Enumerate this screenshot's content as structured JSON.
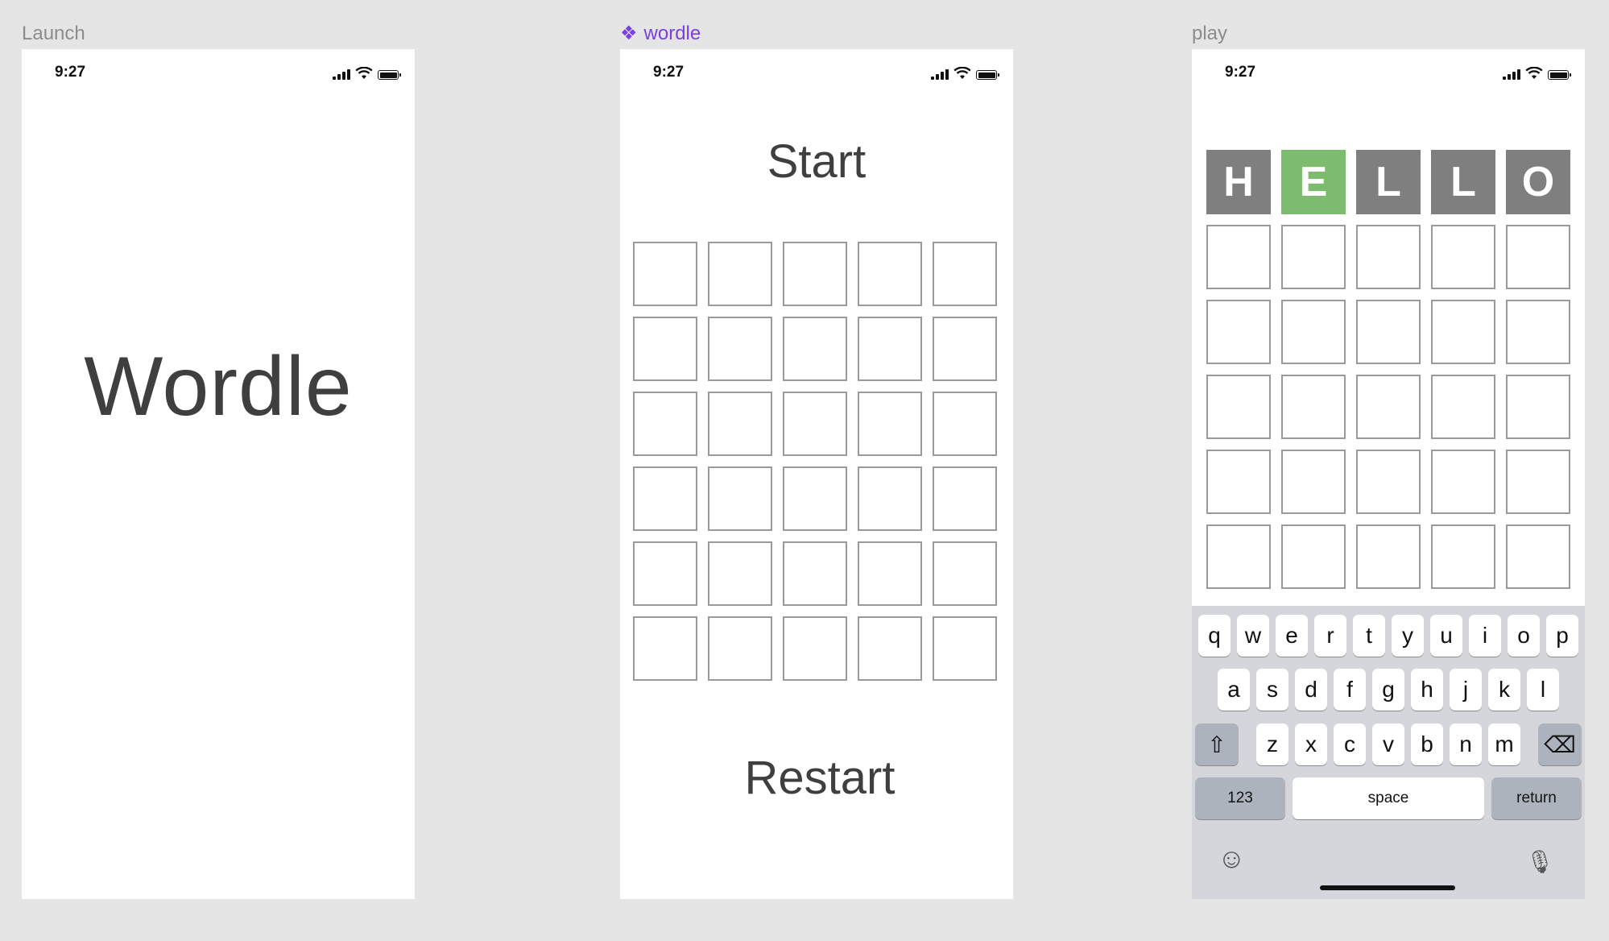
{
  "frames": {
    "launch": {
      "label": "Launch",
      "time": "9:27",
      "title": "Wordle"
    },
    "wordle": {
      "label": "wordle",
      "time": "9:27",
      "start_label": "Start",
      "restart_label": "Restart",
      "rows": 6,
      "cols": 5
    },
    "play": {
      "label": "play",
      "time": "9:27",
      "guess": [
        {
          "letter": "H",
          "state": "gray"
        },
        {
          "letter": "E",
          "state": "green"
        },
        {
          "letter": "L",
          "state": "gray"
        },
        {
          "letter": "L",
          "state": "gray"
        },
        {
          "letter": "O",
          "state": "gray"
        }
      ],
      "empty_rows": 5,
      "keyboard": {
        "row1": [
          "q",
          "w",
          "e",
          "r",
          "t",
          "y",
          "u",
          "i",
          "o",
          "p"
        ],
        "row2": [
          "a",
          "s",
          "d",
          "f",
          "g",
          "h",
          "j",
          "k",
          "l"
        ],
        "row3": [
          "z",
          "x",
          "c",
          "v",
          "b",
          "n",
          "m"
        ],
        "numbers_label": "123",
        "space_label": "space",
        "return_label": "return",
        "shift_icon": "⇧",
        "backspace_icon": "⌫",
        "emoji_icon": "☺",
        "mic_icon": "🎙"
      }
    }
  },
  "colors": {
    "canvas": "#e5e5e5",
    "tile_gray": "#7f7f7f",
    "tile_green": "#7dbb6f",
    "component_label": "#7b3fe4"
  },
  "icons": {
    "component": "❖"
  }
}
